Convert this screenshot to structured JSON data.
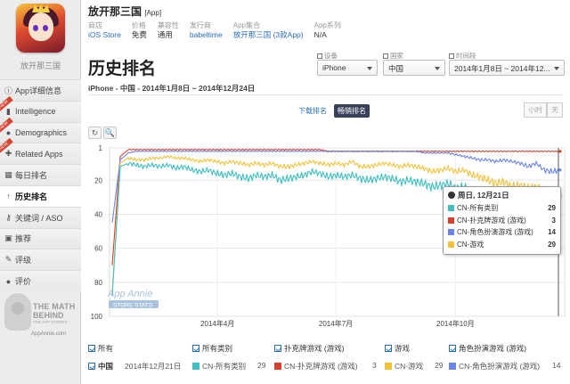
{
  "app": {
    "name": "放开那三国",
    "platform_tag": "[App]",
    "sidebar_name": "放开那三国"
  },
  "meta": [
    {
      "label": "商店",
      "value": "iOS Store",
      "link": true
    },
    {
      "label": "价格",
      "value": "免费",
      "link": false
    },
    {
      "label": "兼容性",
      "value": "通用",
      "link": false
    },
    {
      "label": "发行商",
      "value": "babeltime",
      "link": true
    },
    {
      "label": "App集合",
      "value": "放开那三国 (3款App)",
      "link": true
    },
    {
      "label": "App系列",
      "value": "N/A",
      "link": false
    }
  ],
  "sidebar": {
    "items": [
      {
        "label": "App详细信息",
        "icon": "info-icon",
        "glyph": "ⓘ",
        "new": false,
        "active": false
      },
      {
        "label": "Intelligence",
        "icon": "chart-icon",
        "glyph": "▮",
        "new": true,
        "active": false
      },
      {
        "label": "Demographics",
        "icon": "person-icon",
        "glyph": "●",
        "new": true,
        "active": false
      },
      {
        "label": "Related Apps",
        "icon": "apps-icon",
        "glyph": "✚",
        "new": true,
        "active": false
      },
      {
        "label": "每日排名",
        "icon": "calendar-icon",
        "glyph": "▦",
        "new": false,
        "active": false
      },
      {
        "label": "历史排名",
        "icon": "arrow-up-icon",
        "glyph": "↑",
        "new": false,
        "active": true
      },
      {
        "label": "关键词 / ASO",
        "icon": "key-icon",
        "glyph": "⚷",
        "new": false,
        "active": false
      },
      {
        "label": "推荐",
        "icon": "feature-icon",
        "glyph": "▣",
        "new": false,
        "active": false
      },
      {
        "label": "评级",
        "icon": "star-icon",
        "glyph": "✎",
        "new": false,
        "active": false
      },
      {
        "label": "评价",
        "icon": "comment-icon",
        "glyph": "●",
        "new": false,
        "active": false
      }
    ],
    "new_tag": "NEW",
    "promo": {
      "line1": "THE MATH",
      "line2": "BEHIND",
      "line3": "THE APP STORES",
      "line4": "AppAnnie.com"
    }
  },
  "page": {
    "title": "历史排名",
    "subtitle": "iPhone - 中国 - 2014年1月8日 ~ 2014年12月24日"
  },
  "filters": {
    "device": {
      "label": "设备",
      "value": "iPhone"
    },
    "country": {
      "label": "国家",
      "value": "中国"
    },
    "date": {
      "label": "时间段",
      "value": "2014年1月8日 ~ 2014年12..."
    }
  },
  "toggles": {
    "downloads": "下载排名",
    "grossing": "畅销排名"
  },
  "granularity": {
    "hour": "小时",
    "day": "天"
  },
  "tools": {
    "reset": "↻",
    "zoom": "🔍"
  },
  "watermark": {
    "line1": "App Annie",
    "line2": "STORE STATS"
  },
  "tooltip": {
    "date": "周日, 12月21日",
    "rows": [
      {
        "name": "CN-所有类别",
        "value": "29",
        "color": "#3fbfc4"
      },
      {
        "name": "CN-扑克牌游戏 (游戏)",
        "value": "3",
        "color": "#d9402b"
      },
      {
        "name": "CN-角色扮演游戏 (游戏)",
        "value": "14",
        "color": "#6b86e8"
      },
      {
        "name": "CN-游戏",
        "value": "29",
        "color": "#f2c33a"
      }
    ]
  },
  "legend": {
    "all": "所有",
    "cat_all": "所有类别",
    "cat_card": "扑克牌游戏 (游戏)",
    "cat_games": "游戏",
    "cat_rpg": "角色扮演游戏 (游戏)"
  },
  "data_row": {
    "country": "中国",
    "date": "2014年12月21日",
    "c1": "CN-所有类别",
    "v1": "29",
    "c2": "CN-扑克牌游戏 (游戏)",
    "v2": "3",
    "c3": "CN-游戏",
    "v3": "29",
    "c4": "CN-角色扮演游戏 (游戏)",
    "v4": "14"
  },
  "chart_data": {
    "type": "line",
    "ylim": [
      100,
      1
    ],
    "y_ticks": [
      "1",
      "20",
      "40",
      "60",
      "80",
      "100"
    ],
    "x_ticks": [
      "2014年4月",
      "2014年7月",
      "2014年10月"
    ],
    "x_range": [
      "2014-01-08",
      "2014-12-24"
    ],
    "series": [
      {
        "name": "CN-扑克牌游戏 (游戏)",
        "color": "#d9402b",
        "values": [
          70,
          6,
          2,
          2,
          2,
          2,
          2,
          2,
          2,
          2,
          2,
          2,
          2,
          2,
          2,
          2,
          2,
          2,
          2,
          2,
          2,
          2,
          2,
          2,
          2,
          2,
          2,
          3,
          3,
          3,
          3,
          3,
          3,
          3,
          3,
          3,
          3,
          3,
          3,
          3,
          3,
          3,
          3,
          3,
          3,
          3,
          3,
          3,
          3,
          3,
          3,
          3,
          3,
          3,
          3,
          3,
          3
        ]
      },
      {
        "name": "CN-角色扮演游戏 (游戏)",
        "color": "#6b86e8",
        "values": [
          45,
          8,
          4,
          3,
          3,
          3,
          3,
          3,
          3,
          3,
          3,
          3,
          3,
          3,
          3,
          3,
          3,
          3,
          3,
          3,
          3,
          3,
          3,
          3,
          3,
          3,
          3,
          3,
          3,
          3,
          3,
          3,
          3,
          3,
          3,
          3,
          3,
          3,
          3,
          4,
          4,
          4,
          4,
          5,
          6,
          7,
          8,
          8,
          9,
          8,
          9,
          10,
          12,
          10,
          14,
          15,
          14
        ]
      },
      {
        "name": "CN-游戏",
        "color": "#f2c33a",
        "values": [
          86,
          10,
          7,
          8,
          8,
          7,
          7,
          6,
          7,
          7,
          8,
          9,
          8,
          9,
          10,
          9,
          10,
          11,
          10,
          11,
          10,
          12,
          12,
          11,
          10,
          9,
          10,
          11,
          10,
          11,
          9,
          12,
          12,
          11,
          10,
          11,
          12,
          11,
          12,
          13,
          15,
          14,
          13,
          15,
          14,
          17,
          18,
          20,
          22,
          21,
          24,
          23,
          25,
          24,
          27,
          29,
          29
        ]
      },
      {
        "name": "CN-所有类别",
        "color": "#3fbfc4",
        "values": [
          88,
          12,
          10,
          11,
          12,
          11,
          12,
          11,
          13,
          12,
          14,
          15,
          14,
          16,
          17,
          16,
          18,
          19,
          17,
          18,
          17,
          20,
          19,
          18,
          17,
          15,
          16,
          18,
          17,
          18,
          17,
          19,
          20,
          19,
          18,
          19,
          21,
          20,
          21,
          22,
          24,
          23,
          22,
          25,
          24,
          27,
          28,
          30,
          31,
          30,
          33,
          32,
          34,
          33,
          35,
          34,
          29
        ]
      }
    ]
  }
}
